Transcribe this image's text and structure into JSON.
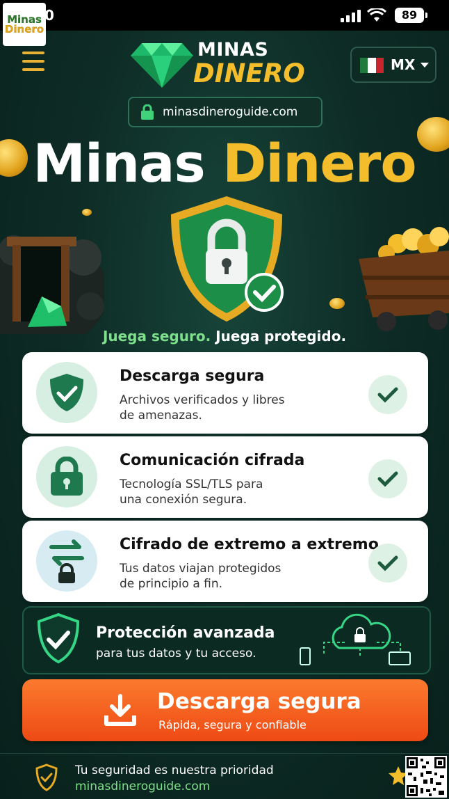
{
  "status_bar": {
    "time": "0",
    "battery": "89"
  },
  "corner_logo": {
    "line1": "Minas",
    "line2": "Dinero"
  },
  "header": {
    "brand_line1": "MINAS",
    "brand_line2": "DINERO",
    "country_code": "MX"
  },
  "url_bar": {
    "text": "minasdineroguide.com"
  },
  "hero": {
    "title_white": "Minas ",
    "title_gold": "Dinero",
    "tagline_green": "Juega seguro.",
    "tagline_white": " Juega protegido."
  },
  "features": [
    {
      "title": "Descarga segura",
      "desc_line1": "Archivos verificados y libres",
      "desc_line2": "de amenazas.",
      "icon": "shield-check-icon"
    },
    {
      "title": "Comunicación cifrada",
      "desc_line1": "Tecnología SSL/TLS para",
      "desc_line2": "una conexión segura.",
      "icon": "padlock-icon"
    },
    {
      "title": "Cifrado de extremo a extremo",
      "desc_line1": "Tus datos viajan protegidos",
      "desc_line2": "de principio a fin.",
      "icon": "transfer-lock-icon"
    }
  ],
  "advanced": {
    "title": "Protección avanzada",
    "desc": "para tus datos y tu acceso."
  },
  "cta": {
    "title": "Descarga segura",
    "subtitle": "Rápida, segura y confiable"
  },
  "footer": {
    "line1": "Tu seguridad es nuestra prioridad",
    "line2": "minasdineroguide.com"
  },
  "colors": {
    "accent_gold": "#f3bd2c",
    "accent_green": "#7fe08c",
    "cta_orange": "#f2611f",
    "bg_dark_green": "#0e2d26"
  }
}
